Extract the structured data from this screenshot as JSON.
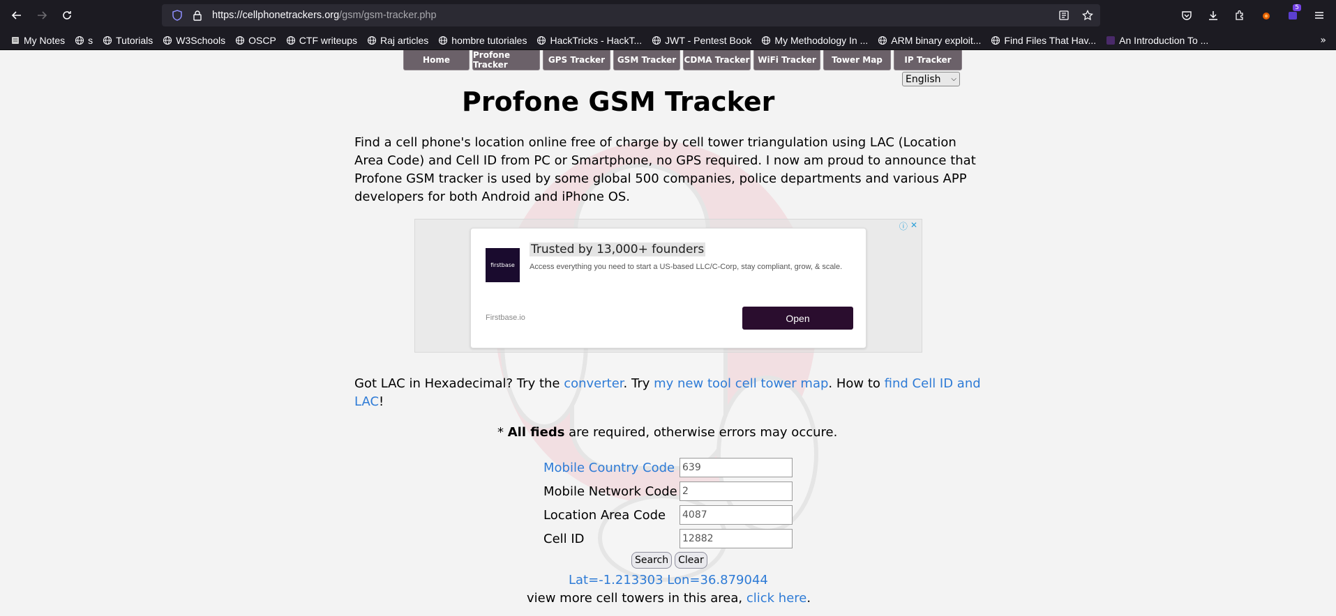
{
  "browser": {
    "url_host": "https://cellphonetrackers.org",
    "url_path": "/gsm/gsm-tracker.php",
    "extensions_badge": "5",
    "bookmarks": [
      {
        "label": "My Notes",
        "icon": "notes-icon"
      },
      {
        "label": "s",
        "icon": "globe-icon"
      },
      {
        "label": "Tutorials",
        "icon": "globe-icon"
      },
      {
        "label": "W3Schools",
        "icon": "globe-icon"
      },
      {
        "label": "OSCP",
        "icon": "globe-icon"
      },
      {
        "label": "CTF writeups",
        "icon": "globe-icon"
      },
      {
        "label": "Raj articles",
        "icon": "globe-icon"
      },
      {
        "label": "hombre tutoriales",
        "icon": "globe-icon"
      },
      {
        "label": "HackTricks - HackT...",
        "icon": "globe-icon"
      },
      {
        "label": "JWT - Pentest Book",
        "icon": "globe-icon"
      },
      {
        "label": "My Methodology In ...",
        "icon": "globe-icon"
      },
      {
        "label": "ARM binary exploit...",
        "icon": "globe-icon"
      },
      {
        "label": "Find Files That Hav...",
        "icon": "globe-icon"
      },
      {
        "label": "An Introduction To ...",
        "icon": "site-icon"
      }
    ]
  },
  "nav": {
    "items": [
      "Home",
      "Profone Tracker",
      "GPS Tracker",
      "GSM Tracker",
      "CDMA Tracker",
      "WiFi Tracker",
      "Tower Map",
      "IP Tracker"
    ],
    "language": "English"
  },
  "main": {
    "title": "Profone GSM Tracker",
    "intro": "Find a cell phone's location online free of charge by cell tower triangulation using LAC (Location Area Code) and Cell ID from PC or Smartphone, no GPS required. I now am proud to announce that Profone GSM tracker is used by some global 500 companies, police departments and various APP developers for both Android and iPhone OS.",
    "hex_prefix": "Got LAC in Hexadecimal? Try the ",
    "hex_link1": "converter",
    "hex_mid1": ". Try ",
    "hex_link2": "my new tool cell tower map",
    "hex_mid2": ". How to ",
    "hex_link3": "find Cell ID and LAC",
    "hex_suffix": "!",
    "required_star": "* ",
    "required_bold": "All fieds",
    "required_rest": " are required, otherwise errors may occure."
  },
  "ad": {
    "title": "Trusted by 13,000+ founders",
    "description": "Access everything you need to start a US-based LLC/C-Corp, stay compliant, grow, & scale.",
    "source": "Firstbase.io",
    "button": "Open",
    "logo_text": "firstbase"
  },
  "form": {
    "mcc_label": "Mobile Country Code",
    "mcc_value": "639",
    "mnc_label": "Mobile Network Code",
    "mnc_value": "2",
    "lac_label": "Location Area Code",
    "lac_value": "4087",
    "cid_label": "Cell ID",
    "cid_value": "12882",
    "search_label": "Search",
    "clear_label": "Clear"
  },
  "result": {
    "coords": "Lat=-1.213303 Lon=36.879044",
    "more_prefix": "view more cell towers in this area, ",
    "more_link": "click here",
    "more_suffix": "."
  }
}
